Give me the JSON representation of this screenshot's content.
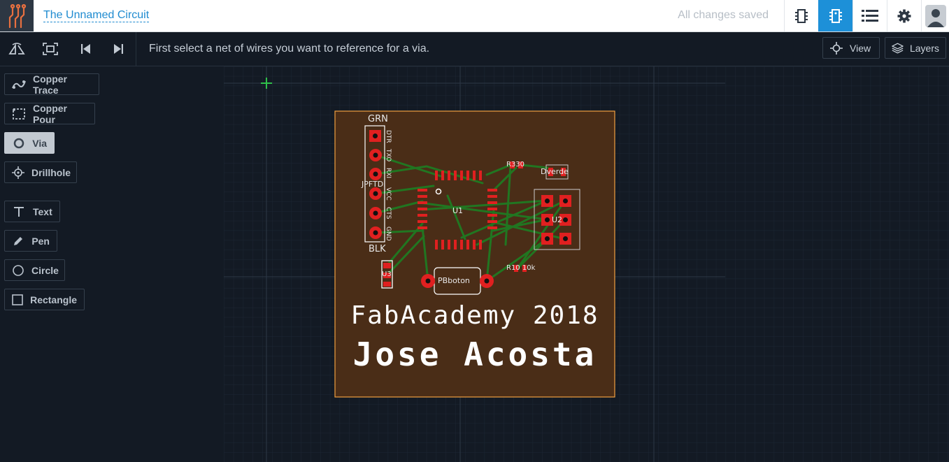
{
  "app": {
    "title": "The Unnamed Circuit",
    "save_status": "All changes saved"
  },
  "topbar": {
    "icons": [
      "chip-icon",
      "pcb-icon",
      "list-icon",
      "gear-icon",
      "avatar-icon"
    ],
    "active_icon": "pcb-icon"
  },
  "toolbar": {
    "buttons": [
      "flip-board-icon",
      "fit-screen-icon",
      "skip-back-icon",
      "skip-forward-icon"
    ],
    "hint": "First select a net of wires you want to reference for a via.",
    "view_label": "View",
    "layers_label": "Layers"
  },
  "tools": {
    "items": [
      {
        "label": "Copper Trace",
        "icon": "copper-trace-icon",
        "active": false
      },
      {
        "label": "Copper Pour",
        "icon": "copper-pour-icon",
        "active": false
      },
      {
        "label": "Via",
        "icon": "via-icon",
        "active": true
      },
      {
        "label": "Drillhole",
        "icon": "drillhole-icon",
        "active": false
      },
      {
        "label": "Text",
        "icon": "text-icon",
        "active": false
      },
      {
        "label": "Pen",
        "icon": "pen-icon",
        "active": false
      },
      {
        "label": "Circle",
        "icon": "circle-icon",
        "active": false
      },
      {
        "label": "Rectangle",
        "icon": "rectangle-icon",
        "active": false
      }
    ]
  },
  "board": {
    "line1": "FabAcademy 2018",
    "line2": "Jose Acosta",
    "labels": {
      "grn": "GRN",
      "blk": "BLK",
      "jpftdi": "JPFTDI",
      "dtr": "DTR",
      "txo": "TXO",
      "rxi": "RXI",
      "vcc": "VCC",
      "cts": "CTS",
      "gnd": "GND",
      "u1": "U1",
      "u2": "U2",
      "u3": "U3",
      "r330": "R330",
      "dverde": "Dverde",
      "pbboton": "PBboton",
      "r10k": "R10 10k"
    },
    "colors": {
      "board_fill": "#4a2d17",
      "board_outline": "#f0a040",
      "pad": "#e02020",
      "trace": "#1f7a22",
      "silk": "#ffffff",
      "accent": "#1d90d8"
    }
  }
}
